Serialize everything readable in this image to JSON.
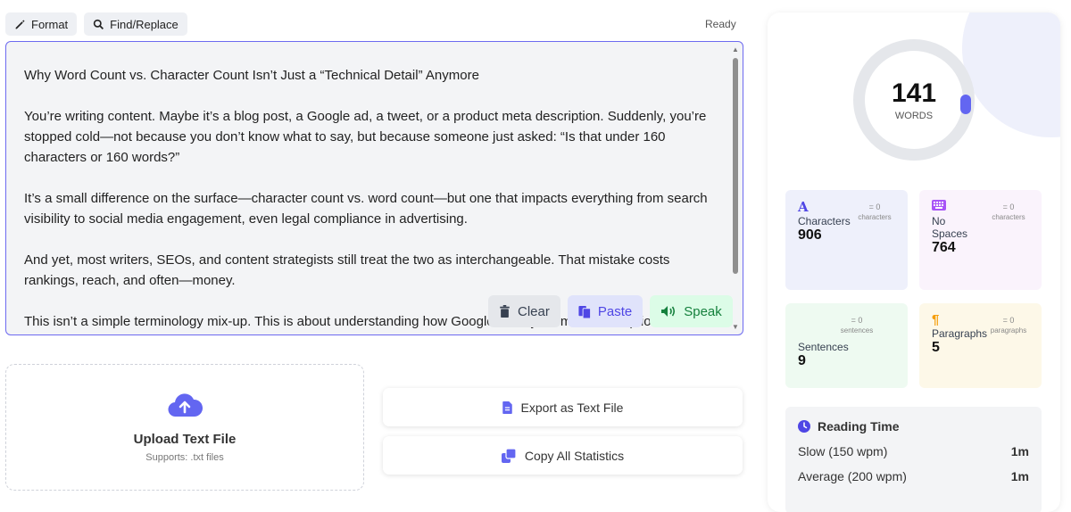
{
  "toolbar": {
    "format_label": "Format",
    "find_label": "Find/Replace",
    "status": "Ready"
  },
  "editor": {
    "paragraphs": [
      "Why Word Count vs. Character Count Isn’t Just a “Technical Detail” Anymore",
      "You’re writing content. Maybe it’s a blog post, a Google ad, a tweet, or a product meta description. Suddenly, you’re stopped cold—not because you don’t know what to say, but because someone just asked: “Is that under 160 characters or 160 words?”",
      "It’s a small difference on the surface—character count vs. word count—but one that impacts everything from search visibility to social media engagement, even legal compliance in advertising.",
      "And yet, most writers, SEOs, and content strategists still treat the two as interchangeable. That mistake costs rankings, reach, and often—money.",
      "This isn’t a simple terminology mix-up. This is about understanding how Google trims your meta descriptions in"
    ],
    "clear_label": "Clear",
    "paste_label": "Paste",
    "speak_label": "Speak"
  },
  "upload": {
    "title": "Upload Text File",
    "subtitle": "Supports: .txt files"
  },
  "actions": {
    "export_label": "Export as Text File",
    "copy_label": "Copy All Statistics"
  },
  "stats": {
    "words": "141",
    "words_label": "WORDS",
    "cards": [
      {
        "label": "Characters",
        "value": "906",
        "mini_top": "= 0",
        "mini_bottom": "characters",
        "icon_char": "A"
      },
      {
        "label": "No Spaces",
        "value": "764",
        "mini_top": "= 0",
        "mini_bottom": "characters"
      },
      {
        "label": "Sentences",
        "value": "9",
        "mini_top": "= 0",
        "mini_bottom": "sentences"
      },
      {
        "label": "Paragraphs",
        "value": "5",
        "mini_top": "= 0",
        "mini_bottom": "paragraphs",
        "icon_char": "¶"
      }
    ],
    "reading": {
      "title": "Reading Time",
      "rows": [
        {
          "label": "Slow (150 wpm)",
          "value": "1m"
        },
        {
          "label": "Average (200 wpm)",
          "value": "1m"
        }
      ]
    }
  },
  "colors": {
    "accent": "#6366f1",
    "paste": "#4f46e5",
    "speak": "#15803d",
    "upload_icon": "#6366f1"
  }
}
